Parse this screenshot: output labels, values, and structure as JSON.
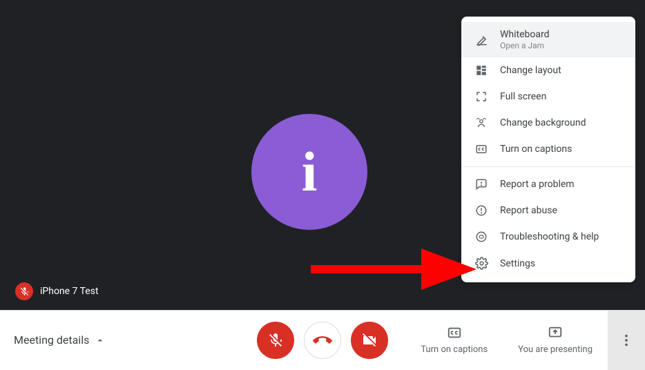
{
  "avatar": {
    "letter": "i"
  },
  "participant": {
    "name": "iPhone 7 Test"
  },
  "bottom": {
    "meeting_details_label": "Meeting details",
    "captions_label": "Turn on captions",
    "presenting_label": "You are presenting"
  },
  "menu": {
    "whiteboard": {
      "label": "Whiteboard",
      "sub": "Open a Jam"
    },
    "layout_label": "Change layout",
    "fullscreen_label": "Full screen",
    "background_label": "Change background",
    "captions_label": "Turn on captions",
    "report_problem_label": "Report a problem",
    "report_abuse_label": "Report abuse",
    "troubleshoot_label": "Troubleshooting & help",
    "settings_label": "Settings"
  }
}
